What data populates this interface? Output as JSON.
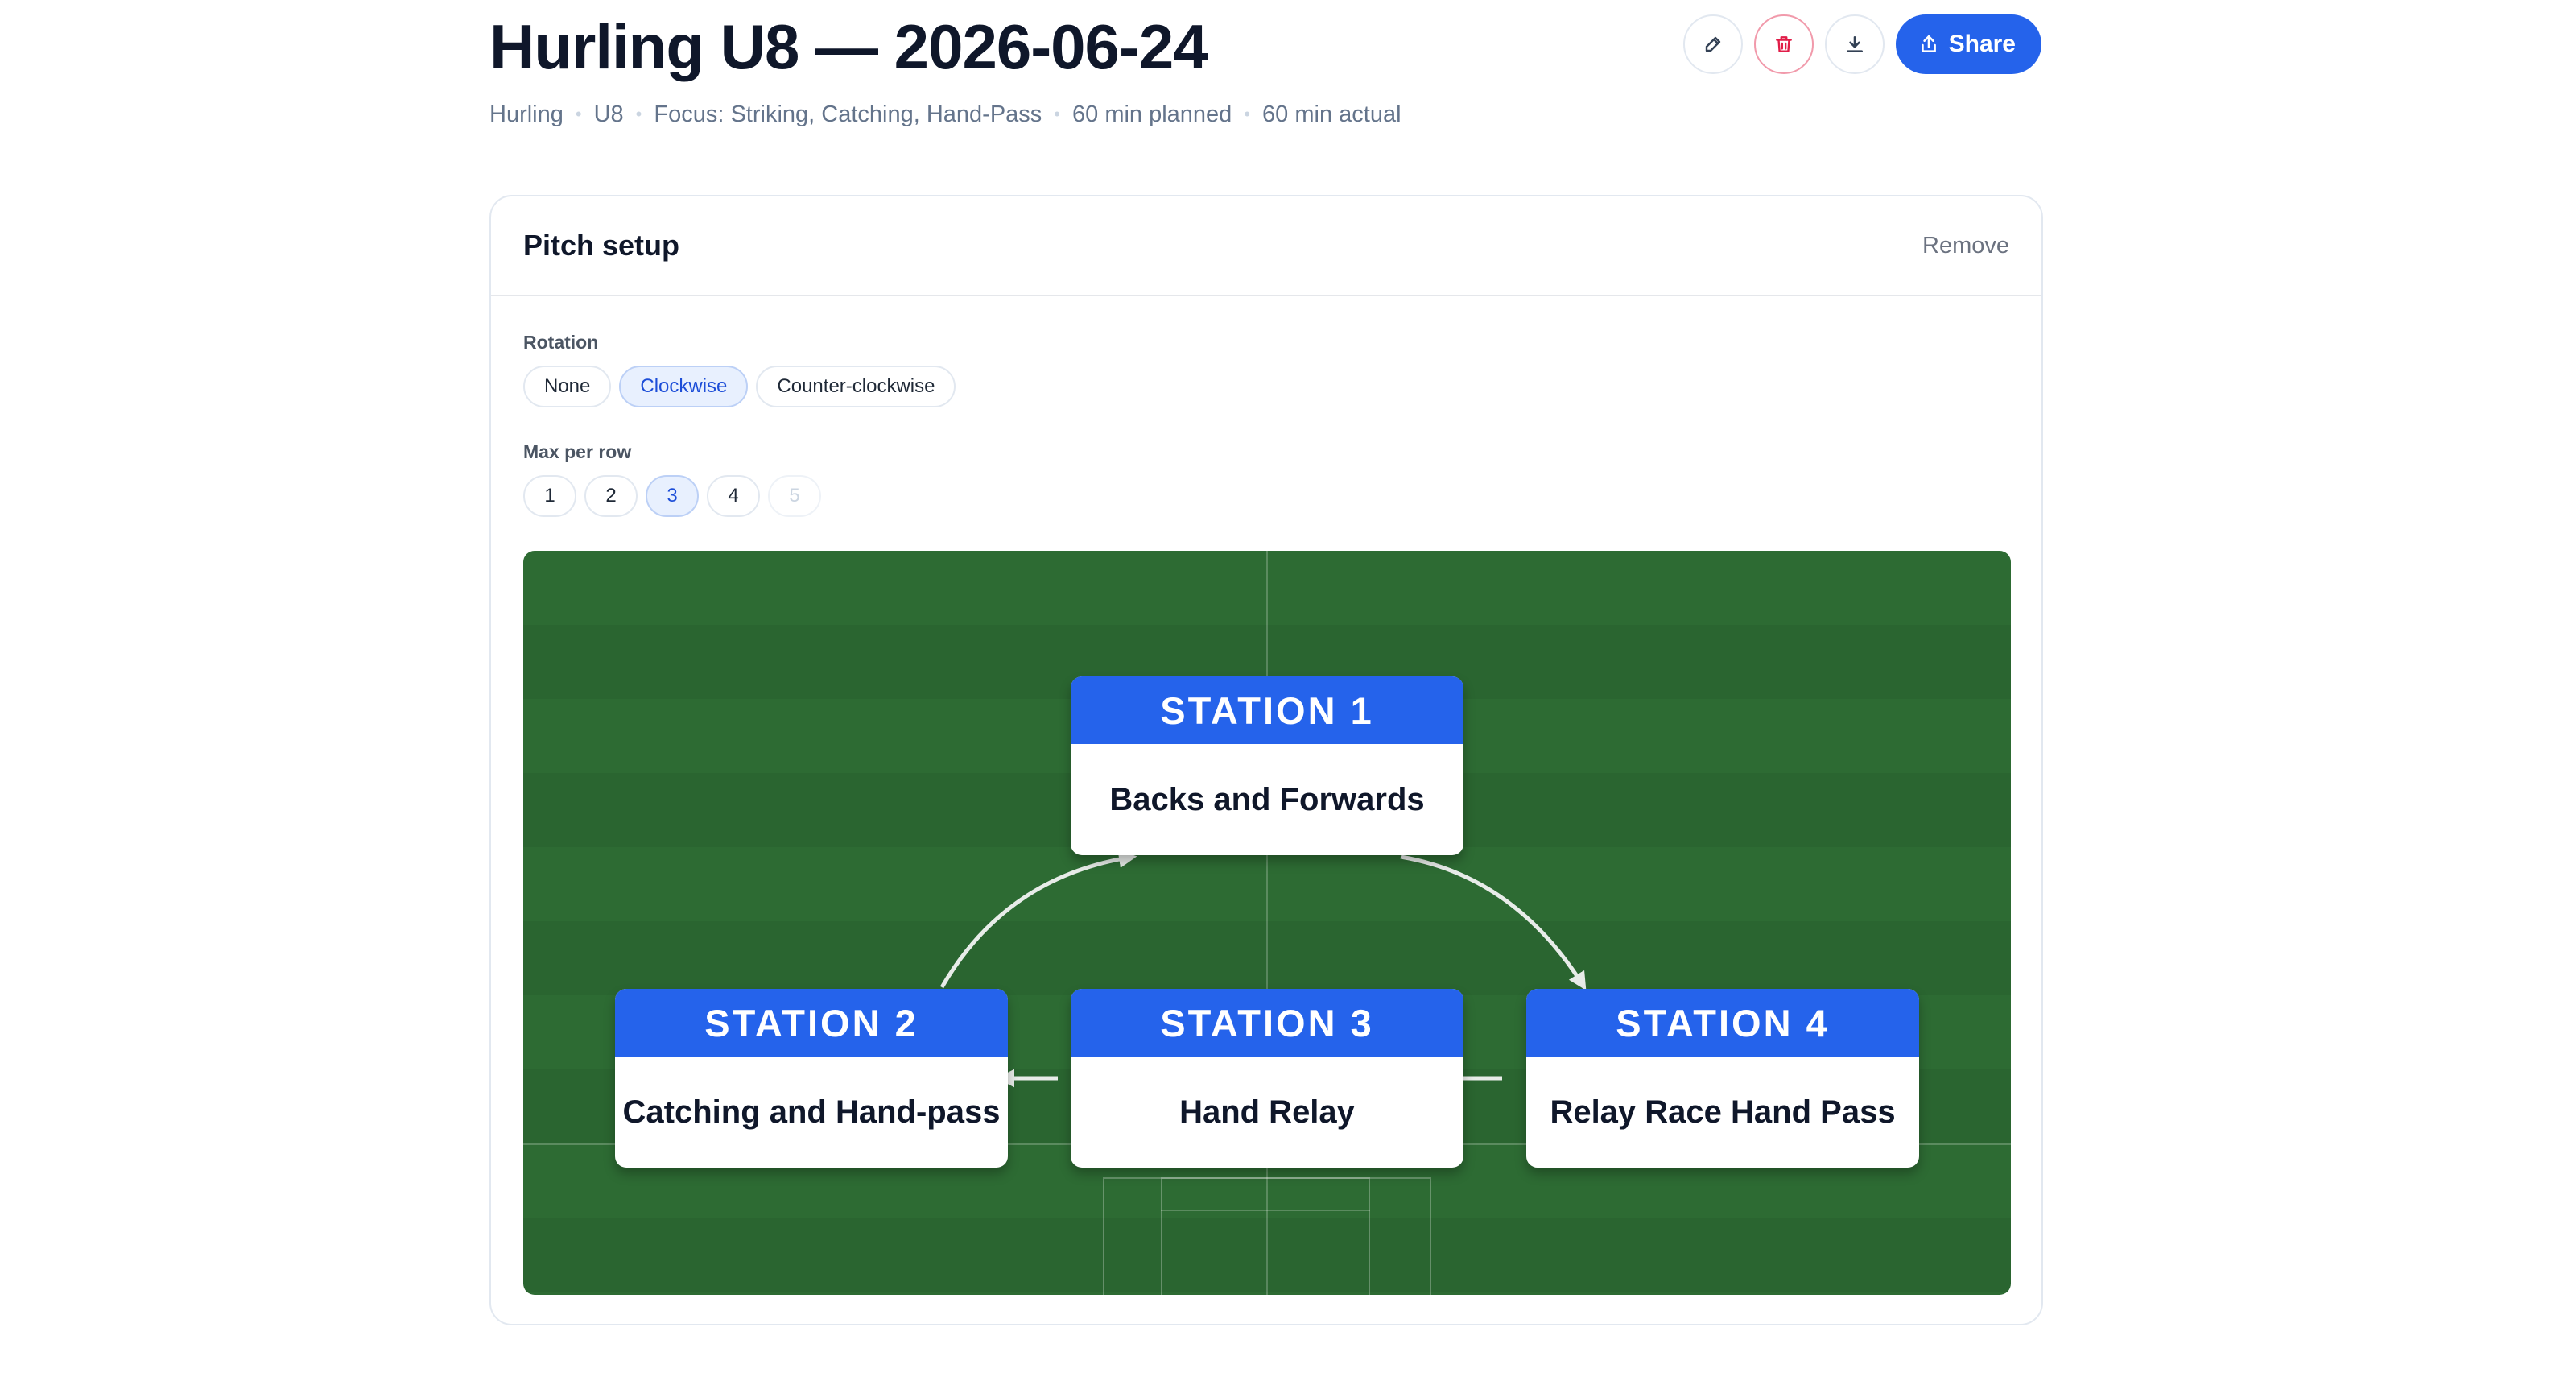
{
  "header": {
    "title": "Hurling U8 — 2026-06-24",
    "meta": [
      "Hurling",
      "U8",
      "Focus: Striking, Catching, Hand-Pass",
      "60 min planned",
      "60 min actual"
    ],
    "share_label": "Share",
    "icons": [
      "pencil-icon",
      "trash-icon",
      "download-icon",
      "share-icon"
    ]
  },
  "card": {
    "title": "Pitch setup",
    "remove_label": "Remove",
    "rotation": {
      "label": "Rotation",
      "options": [
        "None",
        "Clockwise",
        "Counter-clockwise"
      ],
      "selected": "Clockwise"
    },
    "max_per_row": {
      "label": "Max per row",
      "options": [
        "1",
        "2",
        "3",
        "4",
        "5"
      ],
      "selected": "3",
      "disabled": [
        "5"
      ]
    }
  },
  "stations": [
    {
      "header": "STATION 1",
      "name": "Backs and Forwards"
    },
    {
      "header": "STATION 2",
      "name": "Catching and Hand-pass"
    },
    {
      "header": "STATION 3",
      "name": "Hand Relay"
    },
    {
      "header": "STATION 4",
      "name": "Relay Race Hand Pass"
    }
  ],
  "colors": {
    "accent": "#2563eb",
    "danger": "#e11d48",
    "pitch_light": "#2d6b33",
    "pitch_dark": "#2a6530"
  }
}
